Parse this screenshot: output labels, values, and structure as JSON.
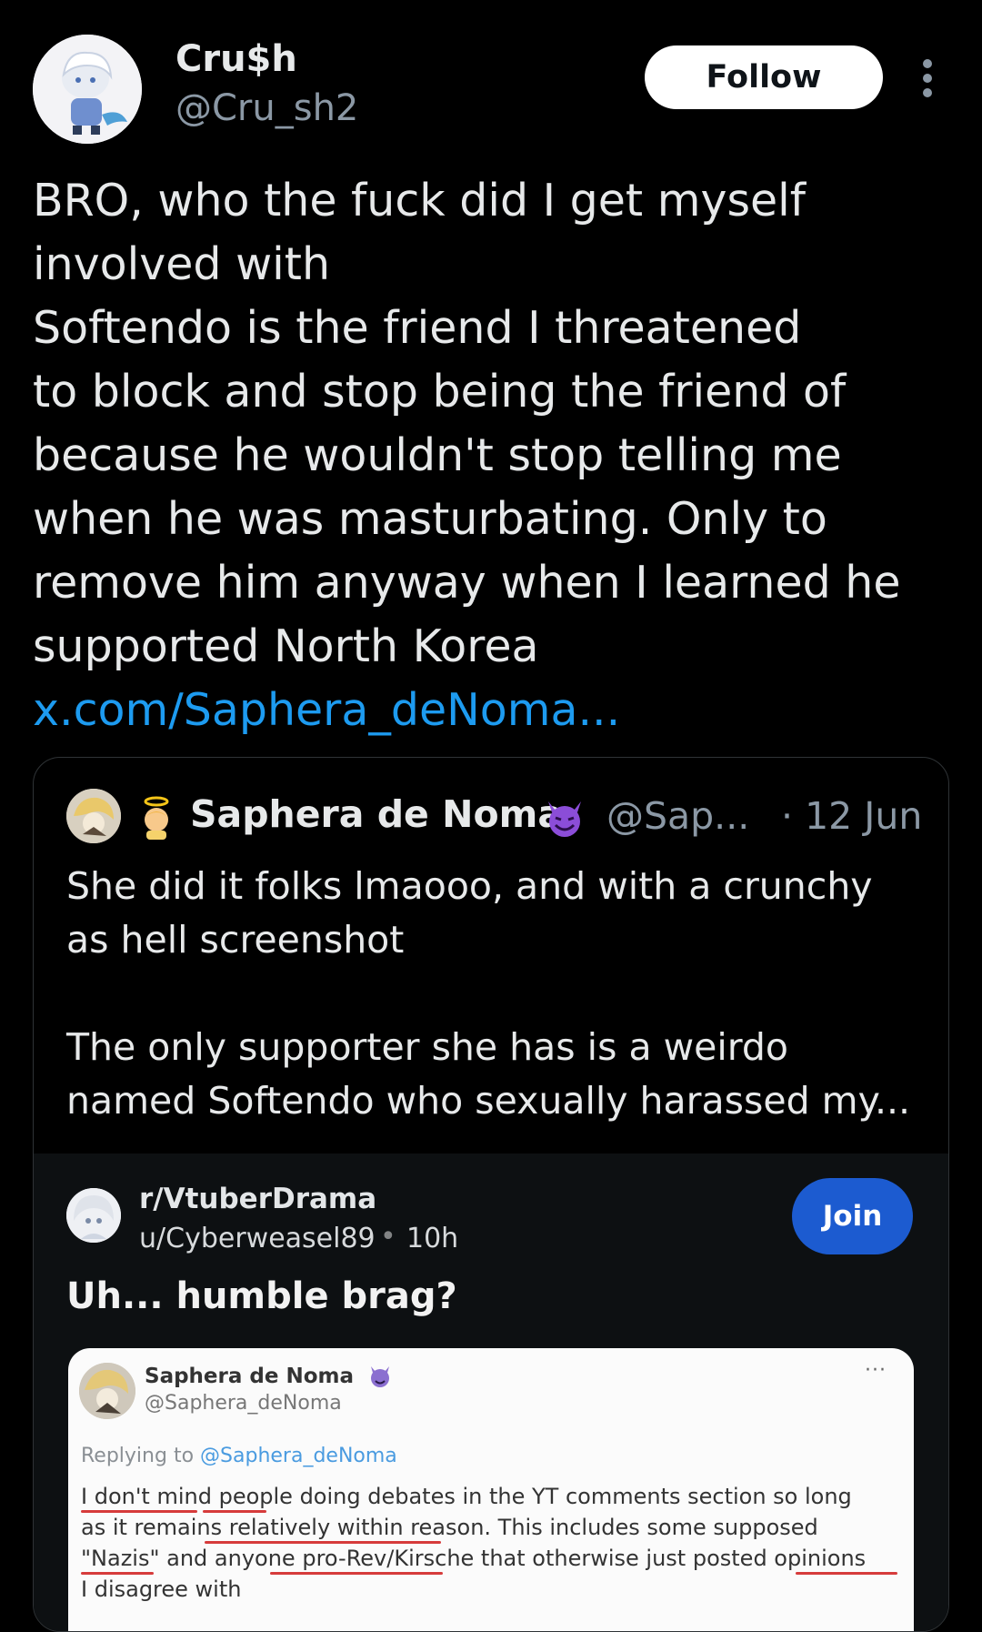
{
  "tweet": {
    "display_name": "Cru$h",
    "handle": "@Cru_sh2",
    "follow_label": "Follow",
    "text": "BRO, who the fuck did I get myself\ninvolved with\nSoftendo is the friend I threatened\nto block and stop being the friend of\nbecause he wouldn't stop telling me\nwhen he was masturbating. Only to\nremove him anyway when I learned he\nsupported North Korea",
    "link": "x.com/Saphera_deNoma..."
  },
  "quote": {
    "name": "Saphera de Noma",
    "handle": "@Sap...",
    "date": "· 12 Jun",
    "text": "She did it folks lmaooo, and with a crunchy\nas hell screenshot\n\nThe only supporter she has is a weirdo\nnamed Softendo who sexually harassed my..."
  },
  "reddit": {
    "subreddit": "r/VtuberDrama",
    "user": "u/Cyberweasel89",
    "dot": "•",
    "time": "10h",
    "join_label": "Join",
    "title": "Uh... humble brag?"
  },
  "screenshot": {
    "name": "Saphera de Noma",
    "handle": "@Saphera_deNoma",
    "reply_prefix": "Replying to",
    "reply_to": "@Saphera_deNoma",
    "body": "I don't mind people doing debates in the YT comments section so long\nas it remains relatively within reason. This includes some supposed\n\"Nazis\" and anyone pro-Rev/Kirsche that otherwise just posted opinions\nI disagree with",
    "more": "···"
  },
  "colors": {
    "background": "#000000",
    "link": "#1d9bf0",
    "join": "#1c5bd0",
    "underline": "#d63b3b"
  }
}
